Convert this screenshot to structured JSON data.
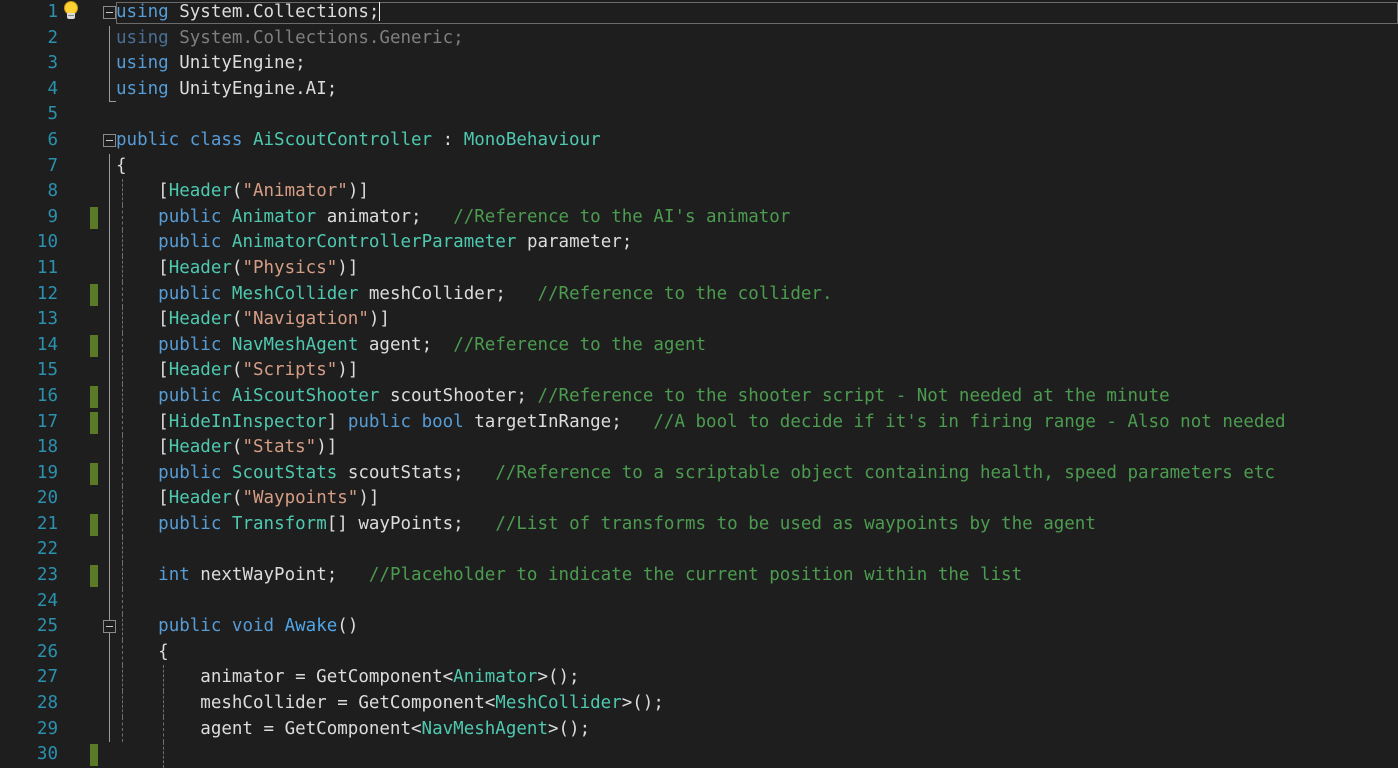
{
  "app": {
    "kind": "code-editor",
    "theme": "dark",
    "language": "csharp",
    "background": "#1e1e1e"
  },
  "colors": {
    "keyword": "#569cd6",
    "type": "#4ec9b0",
    "comment": "#4c9c50",
    "string": "#d69d85",
    "method": "#4fa6e8",
    "identifier": "#dcdcdc",
    "line_number": "#2b91af",
    "change_bar": "#5b7a28",
    "dimmed": "#7f7f7f"
  },
  "gutter": {
    "lightbulb_line": 1,
    "lightbulb_icon": "lightbulb-icon",
    "fold_icon": "collapse-minus-icon",
    "change_bar_lines": [
      9,
      12,
      14,
      16,
      17,
      19,
      21,
      23,
      30
    ]
  },
  "editor": {
    "caret_line": 1,
    "caret_column": 27,
    "first_visible_line": 1,
    "last_visible_line": 30
  },
  "lines": [
    {
      "n": "1",
      "text": "using System.Collections;"
    },
    {
      "n": "2",
      "text": "using System.Collections.Generic;"
    },
    {
      "n": "3",
      "text": "using UnityEngine;"
    },
    {
      "n": "4",
      "text": "using UnityEngine.AI;"
    },
    {
      "n": "5",
      "text": ""
    },
    {
      "n": "6",
      "text": "public class AiScoutController : MonoBehaviour"
    },
    {
      "n": "7",
      "text": "{"
    },
    {
      "n": "8",
      "text": "    [Header(\"Animator\")]"
    },
    {
      "n": "9",
      "text": "    public Animator animator;   //Reference to the AI's animator"
    },
    {
      "n": "10",
      "text": "    public AnimatorControllerParameter parameter;"
    },
    {
      "n": "11",
      "text": "    [Header(\"Physics\")]"
    },
    {
      "n": "12",
      "text": "    public MeshCollider meshCollider;   //Reference to the collider."
    },
    {
      "n": "13",
      "text": "    [Header(\"Navigation\")]"
    },
    {
      "n": "14",
      "text": "    public NavMeshAgent agent;  //Reference to the agent"
    },
    {
      "n": "15",
      "text": "    [Header(\"Scripts\")]"
    },
    {
      "n": "16",
      "text": "    public AiScoutShooter scoutShooter; //Reference to the shooter script - Not needed at the minute"
    },
    {
      "n": "17",
      "text": "    [HideInInspector] public bool targetInRange;   //A bool to decide if it's in firing range - Also not needed"
    },
    {
      "n": "18",
      "text": "    [Header(\"Stats\")]"
    },
    {
      "n": "19",
      "text": "    public ScoutStats scoutStats;   //Reference to a scriptable object containing health, speed parameters etc"
    },
    {
      "n": "20",
      "text": "    [Header(\"Waypoints\")]"
    },
    {
      "n": "21",
      "text": "    public Transform[] wayPoints;   //List of transforms to be used as waypoints by the agent"
    },
    {
      "n": "22",
      "text": ""
    },
    {
      "n": "23",
      "text": "    int nextWayPoint;   //Placeholder to indicate the current position within the list"
    },
    {
      "n": "24",
      "text": ""
    },
    {
      "n": "25",
      "text": "    public void Awake()"
    },
    {
      "n": "26",
      "text": "    {"
    },
    {
      "n": "27",
      "text": "        animator = GetComponent<Animator>();"
    },
    {
      "n": "28",
      "text": "        meshCollider = GetComponent<MeshCollider>();"
    },
    {
      "n": "29",
      "text": "        agent = GetComponent<NavMeshAgent>();"
    },
    {
      "n": "30",
      "text": ""
    }
  ],
  "tokens": {
    "l1": [
      {
        "t": "using",
        "c": "kw"
      },
      {
        "t": " System.Collections;",
        "c": "id"
      }
    ],
    "l2": [
      {
        "t": "using",
        "c": "dim-kw"
      },
      {
        "t": " System.Collections.Generic;",
        "c": "dim"
      }
    ],
    "l3": [
      {
        "t": "using",
        "c": "kw"
      },
      {
        "t": " UnityEngine;",
        "c": "id"
      }
    ],
    "l4": [
      {
        "t": "using",
        "c": "kw"
      },
      {
        "t": " UnityEngine.AI;",
        "c": "id"
      }
    ],
    "l6": [
      {
        "t": "public class ",
        "c": "kw"
      },
      {
        "t": "AiScoutController",
        "c": "type"
      },
      {
        "t": " : ",
        "c": "id"
      },
      {
        "t": "MonoBehaviour",
        "c": "type"
      }
    ],
    "l7": [
      {
        "t": "{",
        "c": "punct"
      }
    ],
    "l8": [
      {
        "t": "    [",
        "c": "punct"
      },
      {
        "t": "Header",
        "c": "type"
      },
      {
        "t": "(",
        "c": "punct"
      },
      {
        "t": "\"Animator\"",
        "c": "str"
      },
      {
        "t": ")]",
        "c": "punct"
      }
    ],
    "l9": [
      {
        "t": "    ",
        "c": "id"
      },
      {
        "t": "public ",
        "c": "kw"
      },
      {
        "t": "Animator",
        "c": "type"
      },
      {
        "t": " animator;   ",
        "c": "id"
      },
      {
        "t": "//Reference to the AI's animator",
        "c": "cmt"
      }
    ],
    "l10": [
      {
        "t": "    ",
        "c": "id"
      },
      {
        "t": "public ",
        "c": "kw"
      },
      {
        "t": "AnimatorControllerParameter",
        "c": "type"
      },
      {
        "t": " parameter;",
        "c": "id"
      }
    ],
    "l11": [
      {
        "t": "    [",
        "c": "punct"
      },
      {
        "t": "Header",
        "c": "type"
      },
      {
        "t": "(",
        "c": "punct"
      },
      {
        "t": "\"Physics\"",
        "c": "str"
      },
      {
        "t": ")]",
        "c": "punct"
      }
    ],
    "l12": [
      {
        "t": "    ",
        "c": "id"
      },
      {
        "t": "public ",
        "c": "kw"
      },
      {
        "t": "MeshCollider",
        "c": "type"
      },
      {
        "t": " meshCollider;   ",
        "c": "id"
      },
      {
        "t": "//Reference to the collider.",
        "c": "cmt"
      }
    ],
    "l13": [
      {
        "t": "    [",
        "c": "punct"
      },
      {
        "t": "Header",
        "c": "type"
      },
      {
        "t": "(",
        "c": "punct"
      },
      {
        "t": "\"Navigation\"",
        "c": "str"
      },
      {
        "t": ")]",
        "c": "punct"
      }
    ],
    "l14": [
      {
        "t": "    ",
        "c": "id"
      },
      {
        "t": "public ",
        "c": "kw"
      },
      {
        "t": "NavMeshAgent",
        "c": "type"
      },
      {
        "t": " agent;  ",
        "c": "id"
      },
      {
        "t": "//Reference to the agent",
        "c": "cmt"
      }
    ],
    "l15": [
      {
        "t": "    [",
        "c": "punct"
      },
      {
        "t": "Header",
        "c": "type"
      },
      {
        "t": "(",
        "c": "punct"
      },
      {
        "t": "\"Scripts\"",
        "c": "str"
      },
      {
        "t": ")]",
        "c": "punct"
      }
    ],
    "l16": [
      {
        "t": "    ",
        "c": "id"
      },
      {
        "t": "public ",
        "c": "kw"
      },
      {
        "t": "AiScoutShooter",
        "c": "type"
      },
      {
        "t": " scoutShooter; ",
        "c": "id"
      },
      {
        "t": "//Reference to the shooter script - Not needed at the minute",
        "c": "cmt"
      }
    ],
    "l17": [
      {
        "t": "    [",
        "c": "punct"
      },
      {
        "t": "HideInInspector",
        "c": "type"
      },
      {
        "t": "] ",
        "c": "punct"
      },
      {
        "t": "public bool",
        "c": "kw"
      },
      {
        "t": " targetInRange;   ",
        "c": "id"
      },
      {
        "t": "//A bool to decide if it's in firing range - Also not needed",
        "c": "cmt"
      }
    ],
    "l18": [
      {
        "t": "    [",
        "c": "punct"
      },
      {
        "t": "Header",
        "c": "type"
      },
      {
        "t": "(",
        "c": "punct"
      },
      {
        "t": "\"Stats\"",
        "c": "str"
      },
      {
        "t": ")]",
        "c": "punct"
      }
    ],
    "l19": [
      {
        "t": "    ",
        "c": "id"
      },
      {
        "t": "public ",
        "c": "kw"
      },
      {
        "t": "ScoutStats",
        "c": "type"
      },
      {
        "t": " scoutStats;   ",
        "c": "id"
      },
      {
        "t": "//Reference to a scriptable object containing health, speed parameters etc",
        "c": "cmt"
      }
    ],
    "l20": [
      {
        "t": "    [",
        "c": "punct"
      },
      {
        "t": "Header",
        "c": "type"
      },
      {
        "t": "(",
        "c": "punct"
      },
      {
        "t": "\"Waypoints\"",
        "c": "str"
      },
      {
        "t": ")]",
        "c": "punct"
      }
    ],
    "l21": [
      {
        "t": "    ",
        "c": "id"
      },
      {
        "t": "public ",
        "c": "kw"
      },
      {
        "t": "Transform",
        "c": "type"
      },
      {
        "t": "[] wayPoints;   ",
        "c": "id"
      },
      {
        "t": "//List of transforms to be used as waypoints by the agent",
        "c": "cmt"
      }
    ],
    "l23": [
      {
        "t": "    ",
        "c": "id"
      },
      {
        "t": "int",
        "c": "kw"
      },
      {
        "t": " nextWayPoint;   ",
        "c": "id"
      },
      {
        "t": "//Placeholder to indicate the current position within the list",
        "c": "cmt"
      }
    ],
    "l25": [
      {
        "t": "    ",
        "c": "id"
      },
      {
        "t": "public void ",
        "c": "kw"
      },
      {
        "t": "Awake",
        "c": "meth"
      },
      {
        "t": "()",
        "c": "punct"
      }
    ],
    "l26": [
      {
        "t": "    {",
        "c": "punct"
      }
    ],
    "l27": [
      {
        "t": "        animator = GetComponent<",
        "c": "id"
      },
      {
        "t": "Animator",
        "c": "type"
      },
      {
        "t": ">();",
        "c": "id"
      }
    ],
    "l28": [
      {
        "t": "        meshCollider = GetComponent<",
        "c": "id"
      },
      {
        "t": "MeshCollider",
        "c": "type"
      },
      {
        "t": ">();",
        "c": "id"
      }
    ],
    "l29": [
      {
        "t": "        agent = GetComponent<",
        "c": "id"
      },
      {
        "t": "NavMeshAgent",
        "c": "type"
      },
      {
        "t": ">();",
        "c": "id"
      }
    ]
  }
}
